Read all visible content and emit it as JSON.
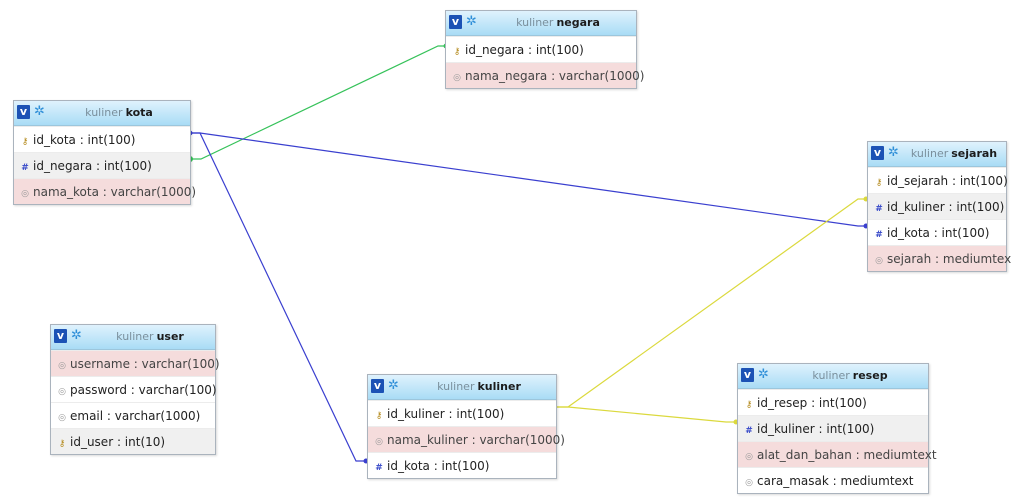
{
  "database": "kuliner",
  "colors": {
    "link_green": "#36c25a",
    "link_blue": "#3a3fcf",
    "link_yellow": "#dbd93d",
    "header_top": "#dff2fd",
    "header_bottom": "#a9dcf5",
    "pink_row": "#f5dcdc",
    "gray_row": "#f0f0f0"
  },
  "tables": {
    "negara": {
      "name": "negara",
      "columns": [
        {
          "text": "id_negara : int(100)",
          "icon": "key-icon",
          "style": "white"
        },
        {
          "text": "nama_negara : varchar(1000)",
          "icon": "text-icon",
          "style": "pink"
        }
      ]
    },
    "kota": {
      "name": "kota",
      "columns": [
        {
          "text": "id_kota : int(100)",
          "icon": "key-icon",
          "style": "white"
        },
        {
          "text": "id_negara : int(100)",
          "icon": "hash-icon",
          "style": "gray"
        },
        {
          "text": "nama_kota : varchar(1000)",
          "icon": "text-icon",
          "style": "pink"
        }
      ]
    },
    "sejarah": {
      "name": "sejarah",
      "columns": [
        {
          "text": "id_sejarah : int(100)",
          "icon": "key-icon",
          "style": "white"
        },
        {
          "text": "id_kuliner : int(100)",
          "icon": "hash-icon",
          "style": "gray"
        },
        {
          "text": "id_kota : int(100)",
          "icon": "hash-icon",
          "style": "white"
        },
        {
          "text": "sejarah : mediumtext",
          "icon": "text-icon",
          "style": "pink"
        }
      ]
    },
    "user": {
      "name": "user",
      "columns": [
        {
          "text": "username : varchar(100)",
          "icon": "text-icon",
          "style": "pink"
        },
        {
          "text": "password : varchar(100)",
          "icon": "text-icon",
          "style": "white"
        },
        {
          "text": "email : varchar(1000)",
          "icon": "text-icon",
          "style": "white"
        },
        {
          "text": "id_user : int(10)",
          "icon": "key-icon",
          "style": "gray"
        }
      ]
    },
    "kuliner": {
      "name": "kuliner",
      "columns": [
        {
          "text": "id_kuliner : int(100)",
          "icon": "key-icon",
          "style": "white"
        },
        {
          "text": "nama_kuliner : varchar(1000)",
          "icon": "text-icon",
          "style": "pink"
        },
        {
          "text": "id_kota : int(100)",
          "icon": "hash-icon",
          "style": "white"
        }
      ]
    },
    "resep": {
      "name": "resep",
      "columns": [
        {
          "text": "id_resep : int(100)",
          "icon": "key-icon",
          "style": "white"
        },
        {
          "text": "id_kuliner : int(100)",
          "icon": "hash-icon",
          "style": "gray"
        },
        {
          "text": "alat_dan_bahan : mediumtext",
          "icon": "text-icon",
          "style": "pink"
        },
        {
          "text": "cara_masak : mediumtext",
          "icon": "text-icon",
          "style": "white"
        }
      ]
    }
  },
  "relations": [
    {
      "from": "kota.id_negara",
      "to": "negara.id_negara",
      "color": "link_green"
    },
    {
      "from": "sejarah.id_kota",
      "to": "kota.id_kota",
      "color": "link_blue"
    },
    {
      "from": "kuliner.id_kota",
      "to": "kota.id_kota",
      "color": "link_blue"
    },
    {
      "from": "sejarah.id_kuliner",
      "to": "kuliner.id_kuliner",
      "color": "link_yellow"
    },
    {
      "from": "resep.id_kuliner",
      "to": "kuliner.id_kuliner",
      "color": "link_yellow"
    }
  ]
}
